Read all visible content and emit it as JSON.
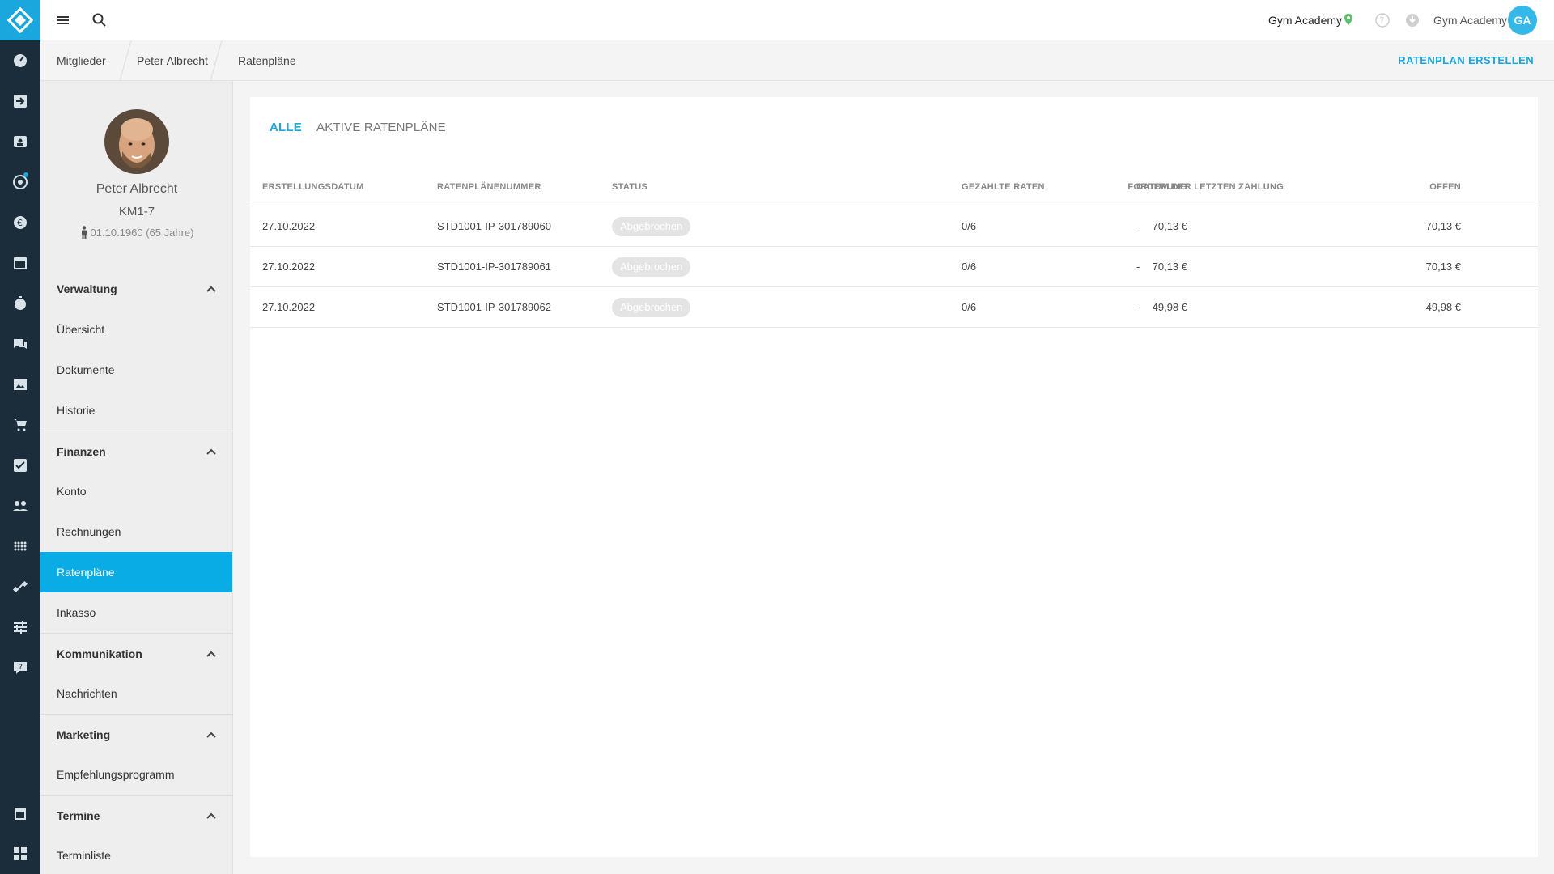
{
  "topbar": {
    "studio": "Gym Academy",
    "user_name": "Gym Academy",
    "user_initials": "GA",
    "icons": [
      "menu-icon",
      "search-icon",
      "location-pin-icon",
      "help-icon",
      "download-icon"
    ]
  },
  "breadcrumb": {
    "items": [
      "Mitglieder",
      "Peter Albrecht",
      "Ratenpläne"
    ],
    "action": "RATENPLAN ERSTELLEN"
  },
  "member": {
    "name": "Peter Albrecht",
    "id": "KM1-7",
    "dob": "01.10.1960 (65 Jahre)"
  },
  "nav": {
    "groups": [
      {
        "label": "Verwaltung",
        "items": [
          "Übersicht",
          "Dokumente",
          "Historie"
        ]
      },
      {
        "label": "Finanzen",
        "items": [
          "Konto",
          "Rechnungen",
          "Ratenpläne",
          "Inkasso"
        ]
      },
      {
        "label": "Kommunikation",
        "items": [
          "Nachrichten"
        ]
      },
      {
        "label": "Marketing",
        "items": [
          "Empfehlungsprogramm"
        ]
      },
      {
        "label": "Termine",
        "items": [
          "Terminliste"
        ]
      }
    ],
    "active_item": "Ratenpläne"
  },
  "rail_icons": [
    "dashboard-icon",
    "checkin-icon",
    "members-icon",
    "leads-icon",
    "finance-icon",
    "calendar-icon",
    "timer-icon",
    "chat-icon",
    "image-icon",
    "shop-icon",
    "tasks-icon",
    "groups-icon",
    "data-icon",
    "equipment-icon",
    "settings-sliders-icon",
    "support-icon",
    "store-icon",
    "apps-icon"
  ],
  "tabs": [
    "ALLE",
    "AKTIVE RATENPLÄNE"
  ],
  "active_tab": "ALLE",
  "table": {
    "headers": [
      "ERSTELLUNGSDATUM",
      "RATENPLÄNENUMMER",
      "STATUS",
      "FORDERUNG",
      "GEZAHLTE RATEN",
      "DATUM DER LETZTEN ZAHLUNG",
      "OFFEN"
    ],
    "rows": [
      {
        "date": "27.10.2022",
        "number": "STD1001-IP-301789060",
        "status": "Abgebrochen",
        "claim": "70,13 €",
        "paid": "0/6",
        "last_payment": "-",
        "open": "70,13 €"
      },
      {
        "date": "27.10.2022",
        "number": "STD1001-IP-301789061",
        "status": "Abgebrochen",
        "claim": "70,13 €",
        "paid": "0/6",
        "last_payment": "-",
        "open": "70,13 €"
      },
      {
        "date": "27.10.2022",
        "number": "STD1001-IP-301789062",
        "status": "Abgebrochen",
        "claim": "49,98 €",
        "paid": "0/6",
        "last_payment": "-",
        "open": "49,98 €"
      }
    ]
  },
  "colors": {
    "accent": "#1aa7dd",
    "rail": "#1b2d3a",
    "active_nav": "#0aace6",
    "badge": "#e4e4e4"
  }
}
